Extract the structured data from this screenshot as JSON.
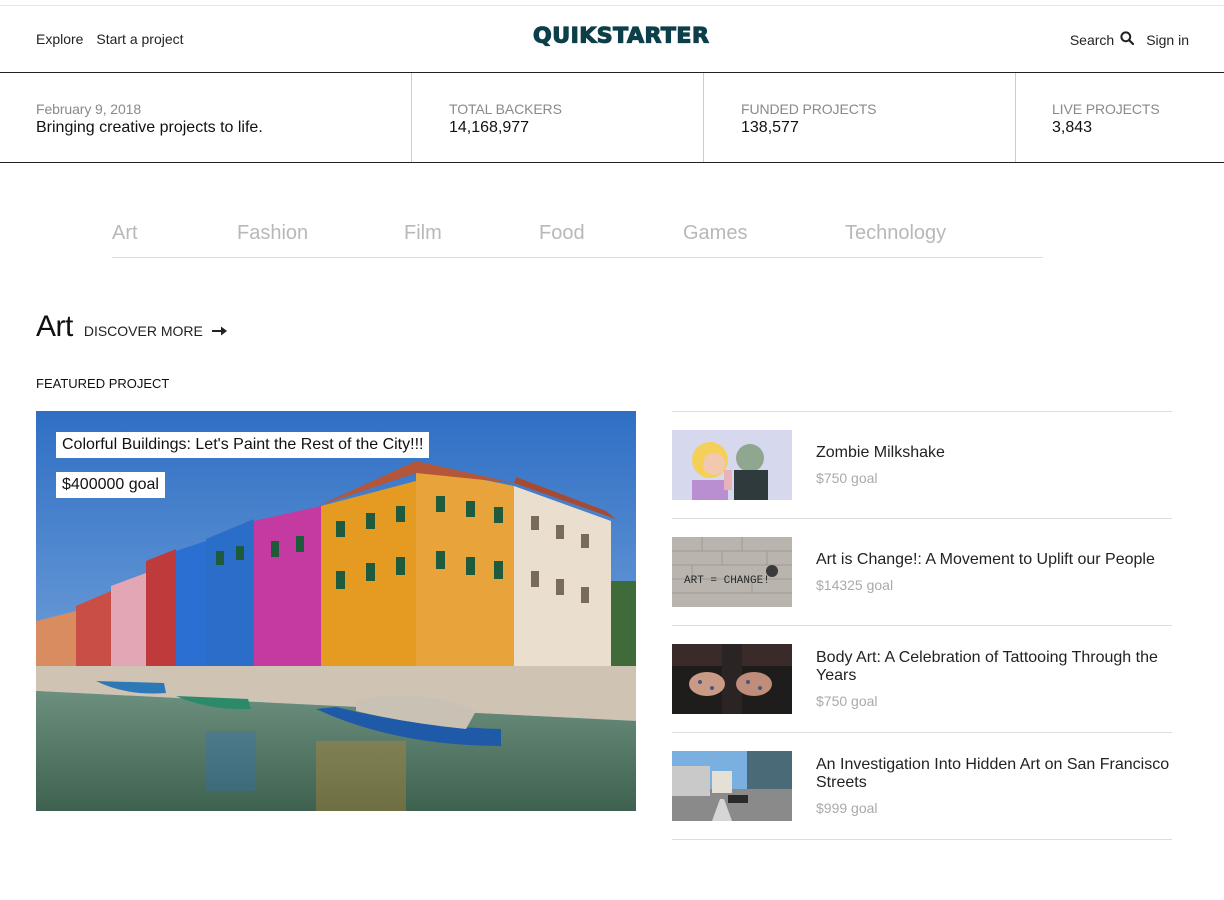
{
  "header": {
    "nav_left": [
      "Explore",
      "Start a project"
    ],
    "logo": "QUIKSTARTER",
    "search_label": "Search",
    "signin_label": "Sign in"
  },
  "stats": {
    "date": "February 9, 2018",
    "tagline": "Bringing creative projects to life.",
    "items": [
      {
        "label": "TOTAL BACKERS",
        "value": "14,168,977"
      },
      {
        "label": "FUNDED PROJECTS",
        "value": "138,577"
      },
      {
        "label": "LIVE PROJECTS",
        "value": "3,843"
      }
    ]
  },
  "categories": [
    "Art",
    "Fashion",
    "Film",
    "Food",
    "Games",
    "Technology"
  ],
  "section": {
    "title": "Art",
    "discover_label": "DISCOVER MORE",
    "featured_label": "FEATURED PROJECT"
  },
  "featured": {
    "title": "Colorful Buildings: Let's Paint the Rest of the City!!!",
    "goal": "$400000 goal"
  },
  "projects": [
    {
      "title": "Zombie Milkshake",
      "goal": "$750 goal"
    },
    {
      "title": "Art is Change!: A Movement to Uplift our People",
      "goal": "$14325 goal"
    },
    {
      "title": "Body Art: A Celebration of Tattooing Through the Years",
      "goal": "$750 goal"
    },
    {
      "title": "An Investigation Into Hidden Art on San Francisco Streets",
      "goal": "$999 goal"
    }
  ],
  "thumb_text": "ART = CHANGE!"
}
